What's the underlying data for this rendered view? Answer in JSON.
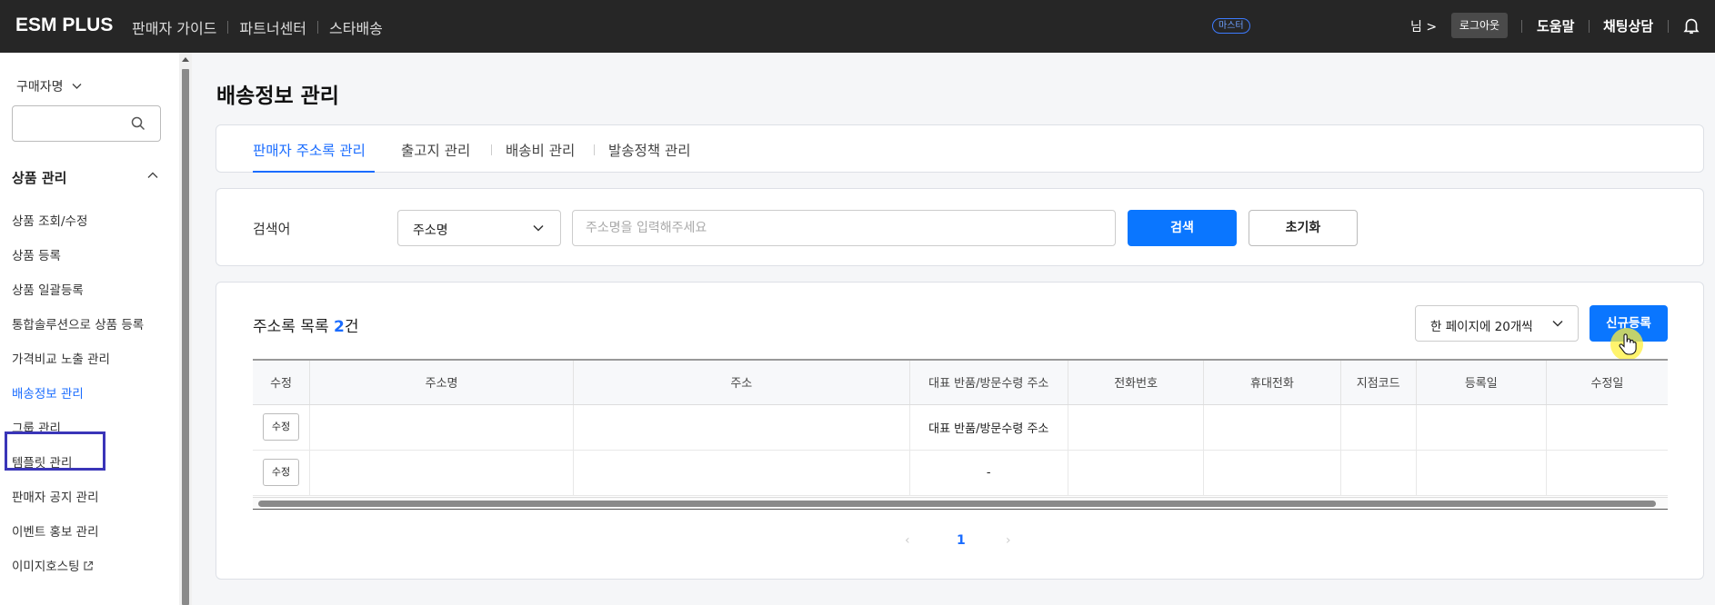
{
  "topbar": {
    "logo": "ESM PLUS",
    "nav": [
      "판매자 가이드",
      "파트너센터",
      "스타배송"
    ],
    "master_badge": "마스터",
    "user_name": "님 >",
    "logout": "로그아웃",
    "help": "도움말",
    "chat": "채팅상담",
    "bell_icon": "bell-icon"
  },
  "sidebar": {
    "buyer_select": "구매자명",
    "search_value": "",
    "group_title": "상품 관리",
    "items": [
      "상품 조회/수정",
      "상품 등록",
      "상품 일괄등록",
      "통합솔루션으로 상품 등록",
      "가격비교 노출 관리",
      "배송정보 관리",
      "그룹 관리",
      "템플릿 관리",
      "판매자 공지 관리",
      "이벤트 홍보 관리",
      "이미지호스팅"
    ],
    "active_index": 5
  },
  "page": {
    "title": "배송정보 관리"
  },
  "tabs": [
    "판매자 주소록 관리",
    "출고지 관리",
    "배송비 관리",
    "발송정책 관리"
  ],
  "search": {
    "label": "검색어",
    "field": "주소명",
    "placeholder": "주소명을 입력해주세요",
    "value": "",
    "search_button": "검색",
    "reset_button": "초기화"
  },
  "list": {
    "title_prefix": "주소록 목록 ",
    "count": "2",
    "title_suffix": "건",
    "per_page": "한 페이지에 20개씩",
    "new_button": "신규등록",
    "columns": [
      "수정",
      "주소명",
      "주소",
      "대표 반품/방문수령 주소",
      "전화번호",
      "휴대전화",
      "지점코드",
      "등록일",
      "수정일"
    ],
    "rows": [
      {
        "edit": "수정",
        "name": "",
        "address": "",
        "rep": "대표 반품/방문수령 주소",
        "phone": "",
        "mobile": "",
        "branch": "",
        "created": "",
        "updated": ""
      },
      {
        "edit": "수정",
        "name": "",
        "address": "",
        "rep": "-",
        "phone": "",
        "mobile": "",
        "branch": "",
        "created": "",
        "updated": ""
      }
    ]
  },
  "pager": {
    "prev": "‹",
    "current": "1",
    "next": "›"
  },
  "colors": {
    "accent": "#0a76ff",
    "topbar": "#262626",
    "active_box": "#3a35b8"
  }
}
